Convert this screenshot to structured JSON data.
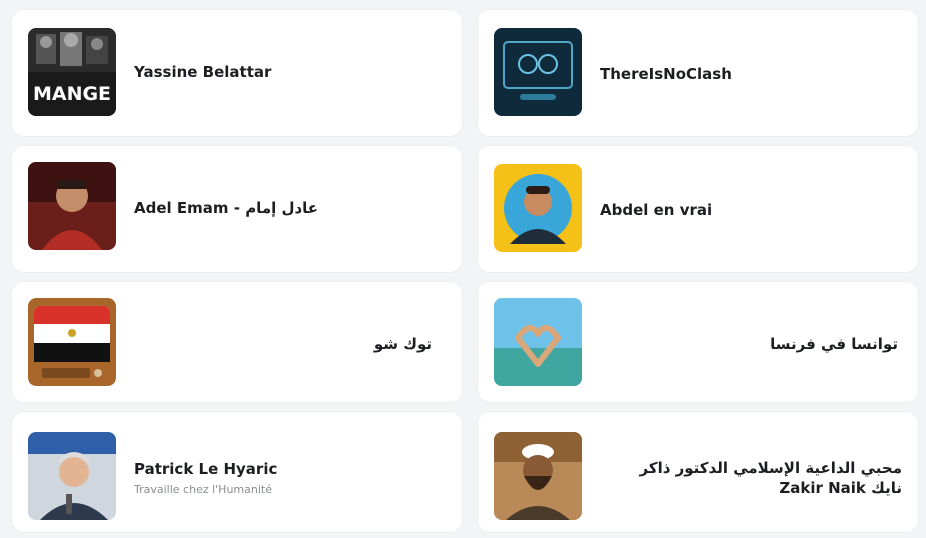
{
  "pages": [
    {
      "name": "Yassine Belattar",
      "thumb_text": "MANGE"
    },
    {
      "name": "ThereIsNoClash"
    },
    {
      "name": "Adel Emam - عادل إمام"
    },
    {
      "name": "Abdel en vrai"
    },
    {
      "name": "توك شو"
    },
    {
      "name": "توانسا في فرنسا"
    },
    {
      "name": "Patrick Le Hyaric",
      "subtitle": "Travaille chez l'Humanité"
    },
    {
      "name": "محبي الداعية الإسلامي الدكتور ذاكر نايك Zakir Naik"
    }
  ],
  "colors": {
    "card_bg": "#ffffff",
    "page_bg": "#f3f4f6",
    "text": "#1c1e21",
    "secondary": "#8a8d91"
  }
}
